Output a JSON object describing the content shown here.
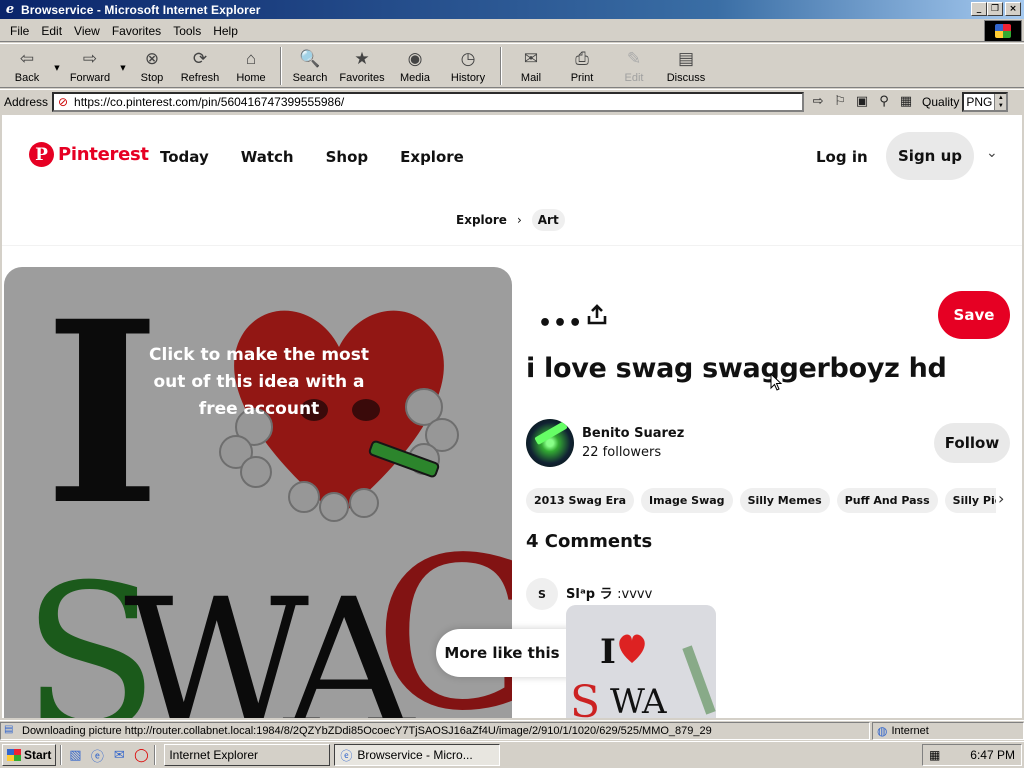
{
  "window": {
    "title": "Browservice - Microsoft Internet Explorer",
    "min": "_",
    "max": "❐",
    "close": "×"
  },
  "menu": [
    "File",
    "Edit",
    "View",
    "Favorites",
    "Tools",
    "Help"
  ],
  "toolbar": {
    "back": "Back",
    "forward": "Forward",
    "stop": "Stop",
    "refresh": "Refresh",
    "home": "Home",
    "search": "Search",
    "favorites": "Favorites",
    "media": "Media",
    "history": "History",
    "mail": "Mail",
    "print": "Print",
    "edit": "Edit",
    "discuss": "Discuss"
  },
  "address": {
    "label": "Address",
    "url": "https://co.pinterest.com/pin/560416747399555986/",
    "quality_label": "Quality",
    "quality_value": "PNG"
  },
  "pinterest": {
    "logo_text": "Pinterest",
    "brand_color": "#e60023",
    "nav": [
      "Today",
      "Watch",
      "Shop",
      "Explore"
    ],
    "login": "Log in",
    "signup": "Sign up",
    "breadcrumb": [
      "Explore",
      "Art"
    ],
    "overlay_text": "Click to make the most out of this idea with a free account",
    "more_like_this": "More like this",
    "save": "Save",
    "pin_title": "i love swag swaggerboyz hd",
    "author": {
      "name": "Benito Suarez",
      "followers": "22 followers"
    },
    "follow": "Follow",
    "tags": [
      "2013 Swag Era",
      "Image Swag",
      "Silly Memes",
      "Puff And Pass",
      "Silly Pictures"
    ],
    "comments_title": "4 Comments",
    "comment": {
      "avatar_letter": "S",
      "user": "Slᵃp ラ",
      "text": ":vvvv"
    },
    "image_letters": {
      "i": "I",
      "s": "S",
      "w": "W",
      "a": "A",
      "g": "G"
    }
  },
  "status": {
    "text": "Downloading picture http://router.collabnet.local:1984/8/2QZYbZDdi85OcoecY7TjSAOSJ16aZf4U/image/2/910/1/1020/629/525/MMO_879_29",
    "zone": "Internet"
  },
  "taskbar": {
    "start": "Start",
    "tasks": [
      "Internet Explorer",
      "Browservice - Micro..."
    ],
    "clock": "6:47 PM"
  }
}
